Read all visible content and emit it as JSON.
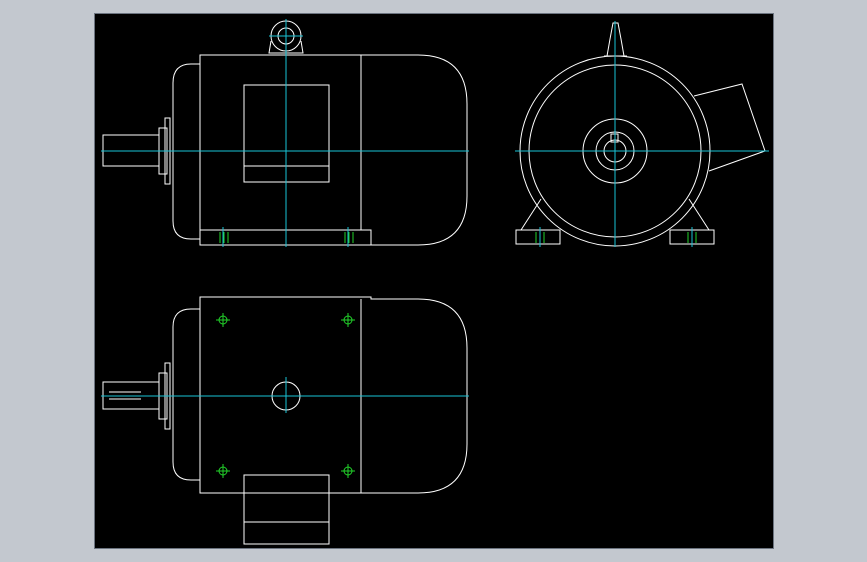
{
  "view": {
    "background": "#000000",
    "frame_color": "#c3c8cf"
  },
  "colors": {
    "outline": "#ffffff",
    "centerline": "#19c3d6",
    "mounting_holes": "#22d32a"
  },
  "drawing": {
    "subject": "electric-motor",
    "views": [
      "front-view",
      "side-view",
      "top-view"
    ]
  }
}
